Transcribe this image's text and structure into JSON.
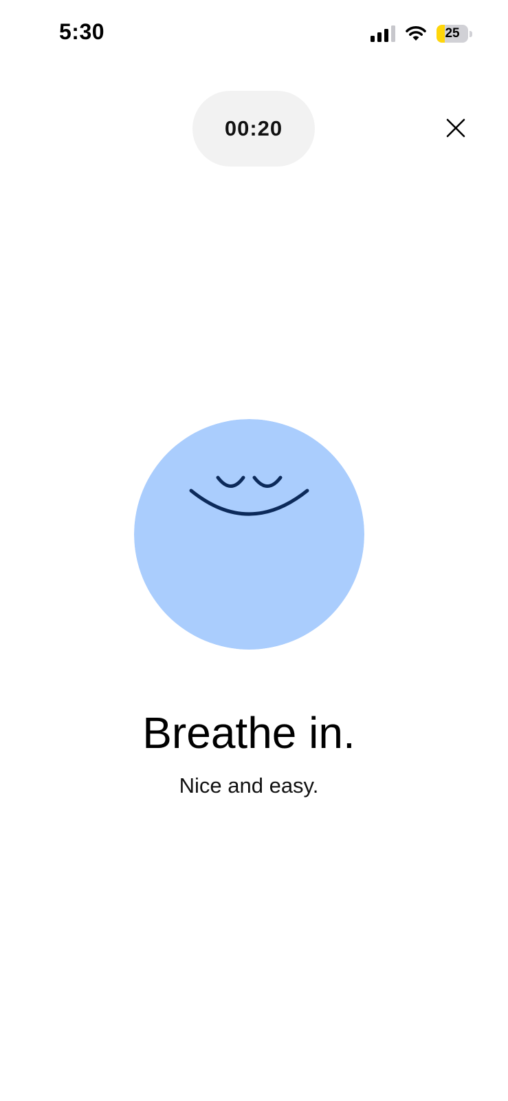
{
  "status_bar": {
    "time": "5:30",
    "battery_level": "25",
    "battery_fraction": 0.25,
    "battery_color": "#ffd60a",
    "icons": [
      "cellular-signal-icon",
      "wifi-icon",
      "battery-icon"
    ]
  },
  "timer": {
    "remaining": "00:20"
  },
  "controls": {
    "close_icon": "close-icon"
  },
  "orb": {
    "color": "#aacdfd",
    "face_color": "#0c2a5a",
    "icon": "smiling-face-icon"
  },
  "prompt": {
    "title": "Breathe in.",
    "subtitle": "Nice and easy."
  }
}
